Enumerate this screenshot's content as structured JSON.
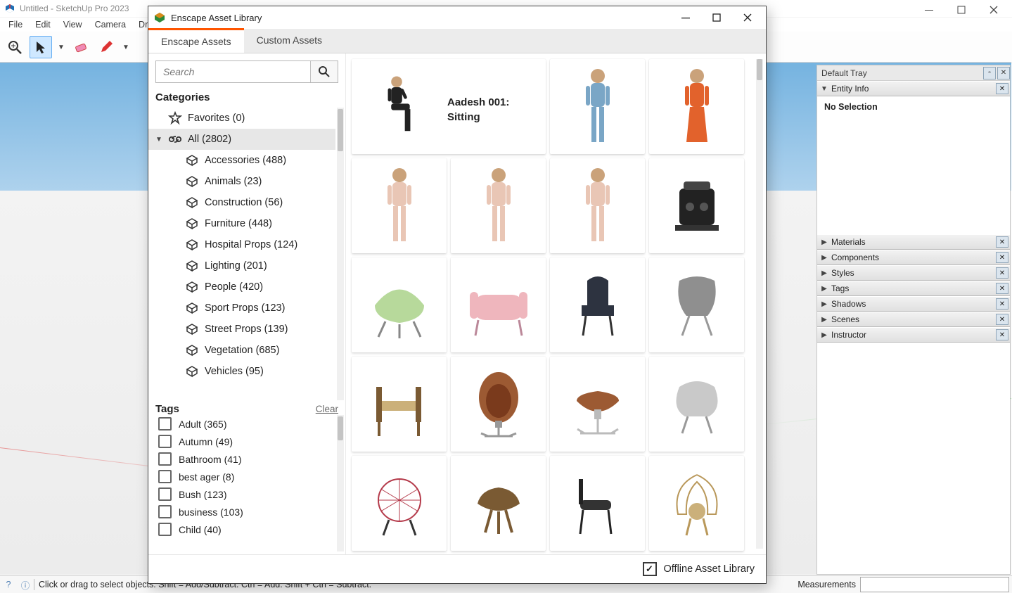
{
  "window_title": "Untitled - SketchUp Pro 2023",
  "menu": [
    "File",
    "Edit",
    "View",
    "Camera",
    "Draw"
  ],
  "status_text": "Click or drag to select objects. Shift = Add/Subtract. Ctrl = Add. Shift + Ctrl = Subtract.",
  "measure_label": "Measurements",
  "tray": {
    "title": "Default Tray",
    "entity_panel": "Entity Info",
    "entity_body": "No Selection",
    "panels": [
      "Materials",
      "Components",
      "Styles",
      "Tags",
      "Shadows",
      "Scenes",
      "Instructor"
    ]
  },
  "dialog": {
    "title": "Enscape Asset Library",
    "tabs": {
      "active": "Enscape Assets",
      "inactive": "Custom Assets"
    },
    "search_placeholder": "Search",
    "categories_title": "Categories",
    "favorites": "Favorites (0)",
    "all": "All (2802)",
    "cats": [
      "Accessories (488)",
      "Animals (23)",
      "Construction (56)",
      "Furniture (448)",
      "Hospital Props (124)",
      "Lighting (201)",
      "People (420)",
      "Sport Props (123)",
      "Street Props (139)",
      "Vegetation (685)",
      "Vehicles (95)"
    ],
    "tags_title": "Tags",
    "tags_clear": "Clear",
    "tags": [
      "Adult (365)",
      "Autumn (49)",
      "Bathroom (41)",
      "best ager (8)",
      "Bush (123)",
      "business (103)",
      "Child (40)"
    ],
    "selected_asset": "Aadesh 001: Sitting",
    "offline_label": "Offline Asset Library"
  }
}
